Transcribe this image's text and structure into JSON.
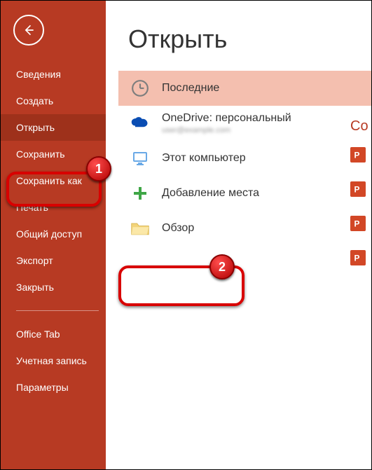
{
  "sidebar": {
    "items": [
      {
        "label": "Сведения"
      },
      {
        "label": "Создать"
      },
      {
        "label": "Открыть"
      },
      {
        "label": "Сохранить"
      },
      {
        "label": "Сохранить как"
      },
      {
        "label": "Печать"
      },
      {
        "label": "Общий доступ"
      },
      {
        "label": "Экспорт"
      },
      {
        "label": "Закрыть"
      }
    ],
    "items2": [
      {
        "label": "Office Tab"
      },
      {
        "label": "Учетная запись"
      },
      {
        "label": "Параметры"
      }
    ]
  },
  "main_title": "Открыть",
  "locations": {
    "recent": "Последние",
    "onedrive": "OneDrive: персональный",
    "onedrive_sub": "user@example.com",
    "thispc": "Этот компьютер",
    "addplace": "Добавление места",
    "browse": "Обзор"
  },
  "right_header_fragment": "Со",
  "callouts": {
    "one": "1",
    "two": "2"
  }
}
